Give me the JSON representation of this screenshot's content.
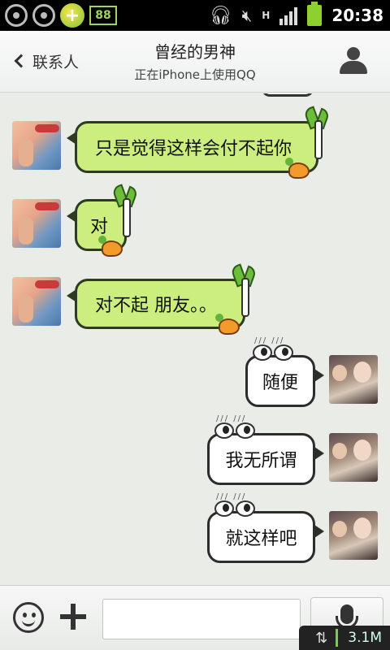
{
  "status_bar": {
    "time": "20:38",
    "app_badge": "88",
    "network_type": "H",
    "network_gen": "3G"
  },
  "header": {
    "back_label": "联系人",
    "title": "曾经的男神",
    "subtitle": "正在iPhone上使用QQ"
  },
  "messages": [
    {
      "side": "left",
      "text": "只是觉得这样会付不起你"
    },
    {
      "side": "left",
      "text": "对"
    },
    {
      "side": "left",
      "text": "对不起 朋友。。"
    },
    {
      "side": "right",
      "text": "随便"
    },
    {
      "side": "right",
      "text": "我无所谓"
    },
    {
      "side": "right",
      "text": "就这样吧"
    }
  ],
  "input": {
    "value": "",
    "placeholder": ""
  },
  "network_speed": "3.1M",
  "colors": {
    "left_bubble": "#cbee7e",
    "right_bubble": "#ffffff",
    "background": "#e9ece7"
  }
}
